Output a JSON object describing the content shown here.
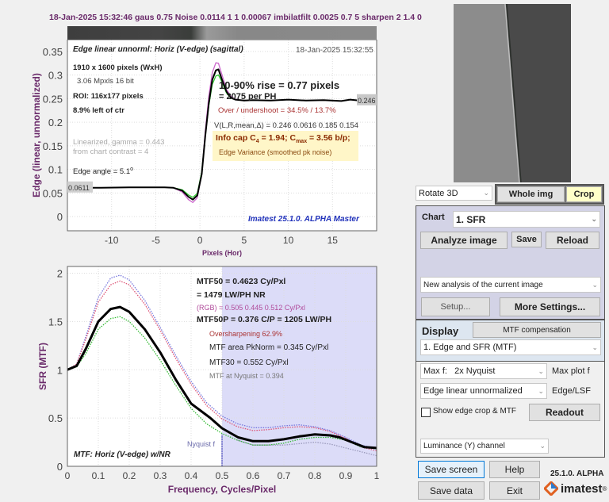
{
  "header": {
    "text": "18-Jan-2025 15:32:46  gaus 0.75 Noise 0.0114 1 1 0.00067 imbilatfilt 0.0025 0.7 5 sharpen 2 1.4 0"
  },
  "colors": {
    "edge_bar_dark": "#3e3e3e",
    "edge_bar_light": "#8a8a8a",
    "axis_label": "#6a2a6a",
    "nyquist_fill": "#dcdcf8",
    "chart_panel": "#d3d3e6",
    "display_panel": "#dde6f0",
    "crop_button": "#ffffc8"
  },
  "chart_data": [
    {
      "type": "line",
      "title": "Edge linear unnorml: Horiz (V-edge) (sagittal)",
      "timestamp": "18-Jan-2025 15:32:55",
      "xlabel": "Pixels (Hor)",
      "ylabel": "Edge (linear, unnormalized)",
      "xlim": [
        -15,
        20
      ],
      "ylim": [
        -0.03,
        0.375
      ],
      "xticks": [
        -10,
        -5,
        0,
        5,
        10,
        15
      ],
      "yticks": [
        0,
        0.05,
        0.1,
        0.15,
        0.2,
        0.25,
        0.3,
        0.35
      ],
      "ytick_labels": [
        "0",
        "0.05",
        "0.1",
        "0.15",
        "0.2",
        "0.25",
        "0.3",
        "0.35"
      ],
      "grid": true,
      "left_level_label": "0.0611",
      "right_level_label": "0.246",
      "series": [
        {
          "color": "#000000",
          "style": "solid",
          "x": [
            -15,
            -12,
            -8,
            -4,
            -3,
            -2,
            -1.3,
            -0.8,
            -0.3,
            0.2,
            0.6,
            1,
            1.4,
            1.8,
            2.1,
            2.5,
            3,
            3.5,
            4,
            5,
            6,
            8,
            10,
            12,
            14,
            16,
            17,
            18,
            20
          ],
          "y": [
            0.061,
            0.061,
            0.062,
            0.062,
            0.061,
            0.055,
            0.042,
            0.036,
            0.045,
            0.09,
            0.17,
            0.24,
            0.29,
            0.31,
            0.312,
            0.29,
            0.265,
            0.252,
            0.248,
            0.246,
            0.247,
            0.246,
            0.248,
            0.246,
            0.247,
            0.245,
            0.248,
            0.246,
            0.246
          ]
        },
        {
          "color": "#cc66cc",
          "style": "solid",
          "x": [
            -3,
            -2,
            -1.3,
            -0.8,
            -0.3,
            0.2,
            0.6,
            1,
            1.4,
            1.8,
            2.1,
            2.5,
            3,
            3.5,
            4,
            5
          ],
          "y": [
            0.061,
            0.052,
            0.036,
            0.03,
            0.04,
            0.09,
            0.18,
            0.255,
            0.305,
            0.326,
            0.325,
            0.3,
            0.27,
            0.255,
            0.249,
            0.246
          ]
        },
        {
          "color": "#33cc33",
          "style": "solid",
          "x": [
            -3,
            -2,
            -1.3,
            -0.8,
            -0.3,
            0.2,
            0.6,
            1,
            1.4,
            1.8,
            2.1,
            2.5,
            3,
            3.5,
            4
          ],
          "y": [
            0.061,
            0.057,
            0.046,
            0.041,
            0.049,
            0.095,
            0.17,
            0.235,
            0.28,
            0.298,
            0.3,
            0.285,
            0.262,
            0.251,
            0.248
          ]
        }
      ],
      "annotations": {
        "pixels": "1910 x 1600 pixels (WxH)",
        "mpxls": "3.06 Mpxls   16 bit",
        "roi": "ROI:  116x177 pixels",
        "position": "8.9% left of ctr",
        "linearized": "Linearized, gamma = 0.443",
        "contrast": "from chart contrast = 4",
        "edge_angle": "Edge angle = 5.1",
        "degree": "o",
        "rise": "10-90% rise = 0.77 pixels",
        "per_ph": "=   2075 per PH",
        "overshoot": "Over / undershoot = 34.5% / 13.7%",
        "variance": "V(L,R,mean,Δ) = 0.246  0.0616  0.185  0.154",
        "info_cap_a": "Info cap C",
        "info_cap_sub": "4",
        "info_cap_b": " = 1.94;  C",
        "info_cap_sub2": "max",
        "info_cap_c": " = 3.56 b/p;",
        "edge_variance": "Edge Variance (smoothed pk noise)",
        "version": "Imatest 25.1.0. ALPHA Master"
      }
    },
    {
      "type": "line",
      "title": "MTF: Horiz (V-edge) w/NR",
      "xlabel": "Frequency, Cycles/Pixel",
      "ylabel": "SFR (MTF)",
      "xlim": [
        0,
        1
      ],
      "ylim": [
        0,
        2.07
      ],
      "xticks": [
        0,
        0.1,
        0.2,
        0.3,
        0.4,
        0.5,
        0.6,
        0.7,
        0.8,
        0.9,
        1
      ],
      "xtick_labels": [
        "0",
        "0.1",
        "0.2",
        "0.3",
        "0.4",
        "0.5",
        "0.6",
        "0.7",
        "0.8",
        "0.9",
        "1"
      ],
      "yticks": [
        0,
        0.5,
        1,
        1.5,
        2
      ],
      "ytick_labels": [
        "0",
        "0.5",
        "1",
        "1.5",
        "2"
      ],
      "grid": true,
      "nyquist_label": "Nyquist f",
      "nyquist": 0.5,
      "series": [
        {
          "color": "#000000",
          "style": "solid",
          "x": [
            0,
            0.03,
            0.06,
            0.1,
            0.14,
            0.17,
            0.2,
            0.25,
            0.3,
            0.35,
            0.4,
            0.45,
            0.4623,
            0.5,
            0.552,
            0.6,
            0.65,
            0.7,
            0.75,
            0.8,
            0.85,
            0.88,
            0.92,
            0.96,
            1
          ],
          "y": [
            1.0,
            1.04,
            1.22,
            1.5,
            1.63,
            1.65,
            1.6,
            1.42,
            1.18,
            0.9,
            0.65,
            0.53,
            0.5,
            0.394,
            0.3,
            0.26,
            0.26,
            0.28,
            0.31,
            0.33,
            0.32,
            0.3,
            0.25,
            0.2,
            0.19
          ]
        },
        {
          "color": "#7777dd",
          "style": "dotted",
          "x": [
            0,
            0.03,
            0.06,
            0.1,
            0.14,
            0.17,
            0.2,
            0.25,
            0.3,
            0.35,
            0.4,
            0.45,
            0.5,
            0.55,
            0.6,
            0.65,
            0.7,
            0.75,
            0.8,
            0.85,
            0.9,
            0.95,
            1
          ],
          "y": [
            1.0,
            1.06,
            1.35,
            1.75,
            1.95,
            1.98,
            1.93,
            1.72,
            1.44,
            1.15,
            0.88,
            0.66,
            0.52,
            0.44,
            0.4,
            0.4,
            0.42,
            0.43,
            0.41,
            0.37,
            0.3,
            0.22,
            0.18
          ]
        },
        {
          "color": "#dd5577",
          "style": "dotted",
          "x": [
            0,
            0.03,
            0.06,
            0.1,
            0.14,
            0.17,
            0.2,
            0.25,
            0.3,
            0.35,
            0.4,
            0.45,
            0.5,
            0.55,
            0.6,
            0.65,
            0.7,
            0.75,
            0.8,
            0.85,
            0.9,
            0.95,
            1
          ],
          "y": [
            1.0,
            1.06,
            1.32,
            1.7,
            1.88,
            1.92,
            1.88,
            1.68,
            1.41,
            1.12,
            0.85,
            0.63,
            0.49,
            0.41,
            0.37,
            0.38,
            0.4,
            0.41,
            0.4,
            0.36,
            0.29,
            0.2,
            0.16
          ]
        },
        {
          "color": "#33bb33",
          "style": "dotted",
          "x": [
            0,
            0.03,
            0.06,
            0.1,
            0.14,
            0.17,
            0.2,
            0.25,
            0.3,
            0.35,
            0.4,
            0.45,
            0.5,
            0.55,
            0.6,
            0.65,
            0.7,
            0.75,
            0.8,
            0.85,
            0.9,
            0.95,
            1
          ],
          "y": [
            1.0,
            1.03,
            1.17,
            1.42,
            1.53,
            1.55,
            1.5,
            1.33,
            1.1,
            0.84,
            0.6,
            0.44,
            0.34,
            0.27,
            0.22,
            0.22,
            0.24,
            0.28,
            0.3,
            0.3,
            0.27,
            0.2,
            0.18
          ]
        },
        {
          "color": "#9999bb",
          "style": "dotted",
          "x": [
            0.55,
            0.6,
            0.7,
            0.8,
            0.85,
            0.9,
            0.95,
            1
          ],
          "y": [
            0.27,
            0.22,
            0.22,
            0.25,
            0.23,
            0.19,
            0.15,
            0.11
          ]
        }
      ],
      "annotations": {
        "mtf50": "MTF50 = 0.4623 Cy/Pxl",
        "lwph": "= 1479 LW/PH  NR",
        "rgb": "(RGB) = 0.505  0.445  0.512 Cy/Pxl",
        "mtf50p": "MTF50P = 0.376 C/P = 1205 LW/PH",
        "oversharpening": "Oversharpening 62.9%",
        "area": "MTF area PkNorm = 0.345 Cy/Pxl",
        "mtf30": "MTF30 = 0.552 Cy/Pxl",
        "nyq": "MTF at Nyquist = 0.394"
      }
    }
  ],
  "panel": {
    "rotate": "Rotate 3D",
    "whole_img": "Whole img",
    "crop": "Crop",
    "chart_label": "Chart",
    "chart_value": "1. SFR",
    "analyze": "Analyze image",
    "save": "Save",
    "reload": "Reload",
    "analysis_mode": "New analysis of the current image",
    "setup": "Setup...",
    "more_settings": "More Settings...",
    "display_label": "Display",
    "mtf_comp": "MTF compensation",
    "display_value": "1. Edge and SFR (MTF)",
    "maxf_prefix": "Max f:",
    "maxf_value": "2x Nyquist",
    "maxf_label": "Max plot f",
    "edge_value": "Edge linear unnormalized",
    "edge_label": "Edge/LSF",
    "show_crop": "Show edge crop & MTF",
    "show_crop_checked": false,
    "readout": "Readout",
    "channel": "Luminance (Y) channel",
    "save_screen": "Save screen",
    "help": "Help",
    "save_data": "Save data",
    "exit": "Exit",
    "version": "25.1.0. ALPHA",
    "logo": "imatest"
  }
}
